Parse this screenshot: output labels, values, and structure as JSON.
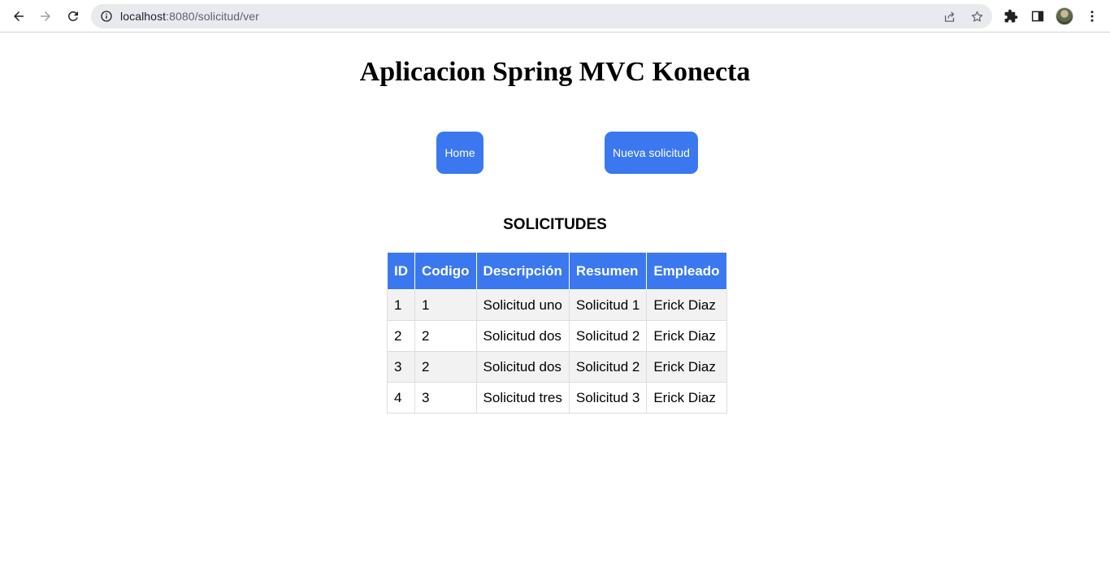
{
  "browser": {
    "url_host": "localhost",
    "url_path": ":8080/solicitud/ver",
    "icons": [
      "back-icon",
      "forward-icon",
      "reload-icon",
      "info-icon",
      "share-icon",
      "star-icon",
      "extensions-icon",
      "side-panel-icon",
      "avatar",
      "menu-icon"
    ]
  },
  "page": {
    "title": "Aplicacion Spring MVC Konecta",
    "buttons": {
      "home": "Home",
      "new_request": "Nueva solicitud"
    },
    "section_title": "SOLICITUDES",
    "accent_color": "#3b78f0"
  },
  "table": {
    "headers": [
      "ID",
      "Codigo",
      "Descripción",
      "Resumen",
      "Empleado"
    ],
    "rows": [
      [
        "1",
        "1",
        "Solicitud uno",
        "Solicitud 1",
        "Erick Diaz"
      ],
      [
        "2",
        "2",
        "Solicitud dos",
        "Solicitud 2",
        "Erick Diaz"
      ],
      [
        "3",
        "2",
        "Solicitud dos",
        "Solicitud 2",
        "Erick Diaz"
      ],
      [
        "4",
        "3",
        "Solicitud tres",
        "Solicitud 3",
        "Erick Diaz"
      ]
    ]
  }
}
